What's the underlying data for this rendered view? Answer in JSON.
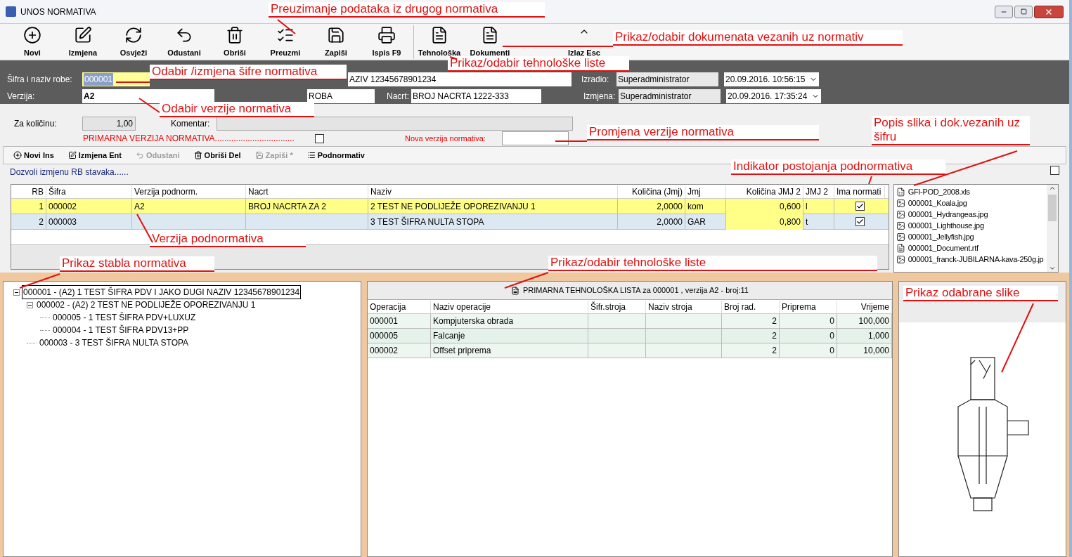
{
  "window": {
    "title": "UNOS NORMATIVA"
  },
  "toolbar": {
    "groups": [
      [
        {
          "label": "Novi"
        },
        {
          "label": "Izmjena"
        },
        {
          "label": "Osvježi"
        },
        {
          "label": "Odustani"
        },
        {
          "label": "Obriši"
        },
        {
          "label": "Preuzmi"
        },
        {
          "label": "Zapiši"
        },
        {
          "label": "Ispis F9"
        }
      ],
      [
        {
          "label": "Tehnološka"
        },
        {
          "label": "Dokumenti"
        }
      ],
      [
        {
          "label": "Izlaz Esc"
        }
      ]
    ]
  },
  "header": {
    "code_label": "Šifra i naziv robe:",
    "code": "000001",
    "name": "AZIV 12345678901234",
    "created_label": "Izradio:",
    "created_by": "Superadministrator",
    "created_at": "20.09.2016. 10:56:15",
    "version_label": "Verzija:",
    "version": "A2",
    "goods_type": "ROBA",
    "drawing_label": "Nacrt:",
    "drawing": "BROJ NACRTA 1222-333",
    "modified_label": "Izmjena:",
    "modified_by": "Superadministrator",
    "modified_at": "20.09.2016. 17:35:24"
  },
  "details": {
    "quantity_label": "Za količinu:",
    "quantity": "1,00",
    "comment_label": "Komentar:",
    "primary_label": "PRIMARNA  VERZIJA NORMATIVA..................................",
    "primary_checked": false,
    "new_version_label": "Nova verzija normativa:"
  },
  "items_toolbar": [
    {
      "label": "Novi Ins",
      "disabled": false
    },
    {
      "label": "Izmjena Ent",
      "disabled": false
    },
    {
      "label": "Odustani",
      "disabled": true
    },
    {
      "label": "Obriši Del",
      "disabled": false
    },
    {
      "label": "Zapiši *",
      "disabled": true
    },
    {
      "label": "Podnormativ",
      "disabled": false
    }
  ],
  "allow_edit": {
    "label": "Dozvoli izmjenu RB stavaka......",
    "checked": false
  },
  "grid": {
    "columns": [
      "RB",
      "Šifra",
      "Verzija podnorm.",
      "Nacrt",
      "Naziv",
      "Količina (Jmj)",
      "Jmj",
      "Količina JMJ 2",
      "JMJ 2",
      "Ima normati"
    ],
    "rows": [
      {
        "cells": [
          "1",
          "000002",
          "A2",
          "BROJ NACRTA ZA 2",
          "2 TEST NE PODLIJEŽE OPOREZIVANJU 1",
          "2,0000",
          "kom",
          "0,600",
          "l"
        ],
        "has_norm": true,
        "selected": true
      },
      {
        "cells": [
          "2",
          "000003",
          "",
          "",
          "3 TEST ŠIFRA NULTA STOPA",
          "2,0000",
          "GAR",
          "0,800",
          "t"
        ],
        "has_norm": true,
        "selected": false
      }
    ]
  },
  "files": [
    {
      "name": "GFI-POD_2008.xls",
      "kind": "sheet"
    },
    {
      "name": "000001_Koala.jpg",
      "kind": "image"
    },
    {
      "name": "000001_Hydrangeas.jpg",
      "kind": "image"
    },
    {
      "name": "000001_Lighthouse.jpg",
      "kind": "image"
    },
    {
      "name": "000001_Jellyfish.jpg",
      "kind": "image"
    },
    {
      "name": "000001_Document.rtf",
      "kind": "document"
    },
    {
      "name": "000001_franck-JUBILARNA-kava-250g.jp",
      "kind": "image"
    }
  ],
  "tree": [
    {
      "label": "000001 - (A2) 1 TEST ŠIFRA PDV I JAKO DUGI NAZIV 12345678901234",
      "selected": true,
      "expanded": true,
      "children": [
        {
          "label": "000002 - (A2) 2 TEST NE PODLIJEŽE OPOREZIVANJU 1",
          "selected": false,
          "expanded": true,
          "children": [
            {
              "label": "000005 - 1 TEST ŠIFRA  PDV+LUXUZ",
              "selected": false
            },
            {
              "label": "000004 - 1 TEST ŠIFRA  PDV13+PP",
              "selected": false
            }
          ]
        },
        {
          "label": "000003 - 3 TEST ŠIFRA NULTA STOPA",
          "selected": false
        }
      ]
    }
  ],
  "tech": {
    "title": "PRIMARNA TEHNOLOŠKA LISTA za 000001 , verzija A2 - broj:11",
    "columns": [
      "Operacija",
      "Naziv operacije",
      "Šifr.stroja",
      "Naziv stroja",
      "Broj rad.",
      "Priprema",
      "Vrijeme"
    ],
    "rows": [
      [
        "000001",
        "Kompjuterska obrada",
        "",
        "",
        "2",
        "0",
        "100,000"
      ],
      [
        "000005",
        "Falcanje",
        "",
        "",
        "2",
        "0",
        "1,000"
      ],
      [
        "000002",
        "Offset priprema",
        "",
        "",
        "2",
        "0",
        "10,000"
      ]
    ]
  },
  "annotations": [
    {
      "text": "Preuzimanje podataka iz drugog normativa"
    },
    {
      "text": "Prikaz/odabir dokumenata vezanih uz normativ"
    },
    {
      "text": "Prikaz/odabir tehnološke liste"
    },
    {
      "text": "Odabir /izmjena šifre normativa"
    },
    {
      "text": "Odabir verzije normativa"
    },
    {
      "text": "Promjena verzije normativa"
    },
    {
      "text": "Popis slika i dok.vezanih uz šifru"
    },
    {
      "text": "Indikator postojanja podnormativa"
    },
    {
      "text": "Verzija podnormativa"
    },
    {
      "text": "Prikaz stabla normativa"
    },
    {
      "text": "Prikaz/odabir tehnološke liste"
    },
    {
      "text": "Prikaz odabrane slike"
    }
  ]
}
